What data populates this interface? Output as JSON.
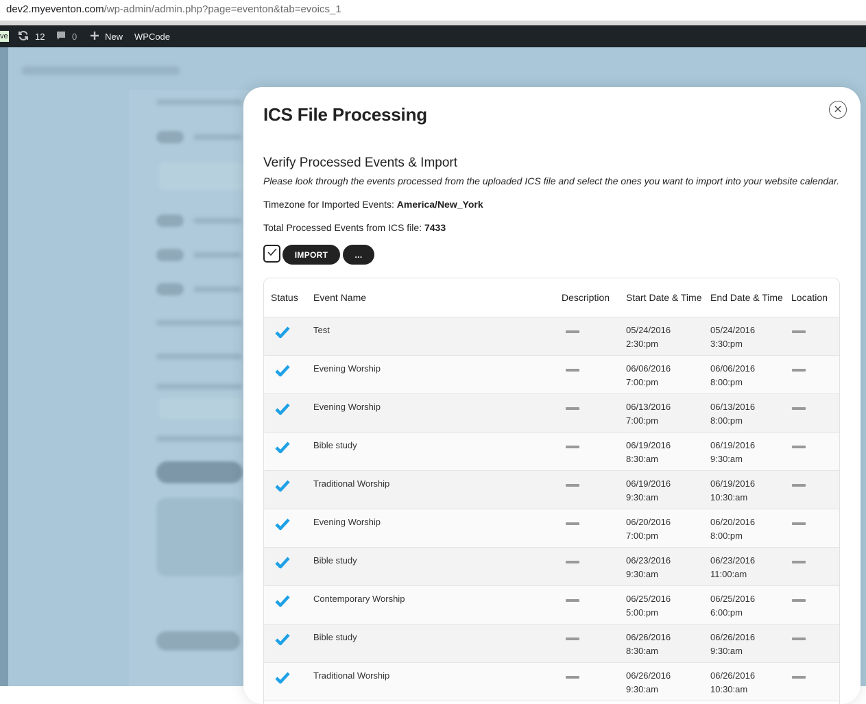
{
  "browser": {
    "url_host": "dev2.myeventon.com",
    "url_path": "/wp-admin/admin.php?page=eventon&tab=evoics_1"
  },
  "adminbar": {
    "live_label": "ve",
    "updates_count": "12",
    "comments_count": "0",
    "new_label": "New",
    "wpcode_label": "WPCode"
  },
  "modal": {
    "title": "ICS File Processing",
    "heading": "Verify Processed Events & Import",
    "description": "Please look through the events processed from the uploaded ICS file and select the ones you want to import into your website calendar.",
    "timezone_label": "Timezone for Imported Events: ",
    "timezone_value": "America/New_York",
    "total_label": "Total Processed Events from ICS file: ",
    "total_value": "7433",
    "import_label": "IMPORT",
    "more_label": "..."
  },
  "table": {
    "headers": {
      "status": "Status",
      "name": "Event Name",
      "description": "Description",
      "start": "Start Date & Time",
      "end": "End Date & Time",
      "location": "Location"
    },
    "rows": [
      {
        "name": "Test",
        "start_date": "05/24/2016",
        "start_time": "2:30:pm",
        "end_date": "05/24/2016",
        "end_time": "3:30:pm"
      },
      {
        "name": "Evening Worship",
        "start_date": "06/06/2016",
        "start_time": "7:00:pm",
        "end_date": "06/06/2016",
        "end_time": "8:00:pm"
      },
      {
        "name": "Evening Worship",
        "start_date": "06/13/2016",
        "start_time": "7:00:pm",
        "end_date": "06/13/2016",
        "end_time": "8:00:pm"
      },
      {
        "name": "Bible study",
        "start_date": "06/19/2016",
        "start_time": "8:30:am",
        "end_date": "06/19/2016",
        "end_time": "9:30:am"
      },
      {
        "name": "Traditional Worship",
        "start_date": "06/19/2016",
        "start_time": "9:30:am",
        "end_date": "06/19/2016",
        "end_time": "10:30:am"
      },
      {
        "name": "Evening Worship",
        "start_date": "06/20/2016",
        "start_time": "7:00:pm",
        "end_date": "06/20/2016",
        "end_time": "8:00:pm"
      },
      {
        "name": "Bible study",
        "start_date": "06/23/2016",
        "start_time": "9:30:am",
        "end_date": "06/23/2016",
        "end_time": "11:00:am"
      },
      {
        "name": "Contemporary Worship",
        "start_date": "06/25/2016",
        "start_time": "5:00:pm",
        "end_date": "06/25/2016",
        "end_time": "6:00:pm"
      },
      {
        "name": "Bible study",
        "start_date": "06/26/2016",
        "start_time": "8:30:am",
        "end_date": "06/26/2016",
        "end_time": "9:30:am"
      },
      {
        "name": "Traditional Worship",
        "start_date": "06/26/2016",
        "start_time": "9:30:am",
        "end_date": "06/26/2016",
        "end_time": "10:30:am"
      }
    ]
  },
  "colors": {
    "check": "#1ea1e6",
    "backdrop": "#a9c7d8",
    "adminbar": "#1d2327"
  },
  "icons": {
    "status": "checkmark-icon",
    "close": "close-icon",
    "updates": "refresh-icon",
    "comments": "comment-icon",
    "new": "plus-icon"
  }
}
